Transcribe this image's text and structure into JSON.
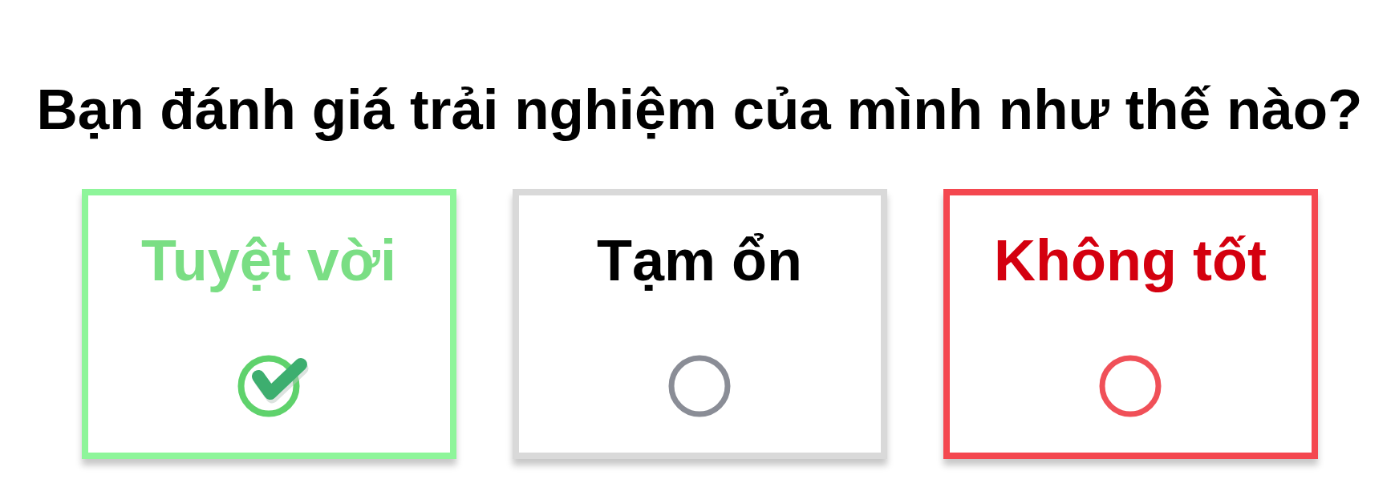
{
  "question": "Bạn đánh giá trải nghiệm của mình như thế nào?",
  "options": [
    {
      "label": "Tuyệt vời",
      "kind": "positive",
      "selected": true,
      "color": "#8ef59a"
    },
    {
      "label": "Tạm ổn",
      "kind": "neutral",
      "selected": false,
      "color": "#d9d9d9"
    },
    {
      "label": "Không tốt",
      "kind": "negative",
      "selected": false,
      "color": "#f4474f"
    }
  ]
}
